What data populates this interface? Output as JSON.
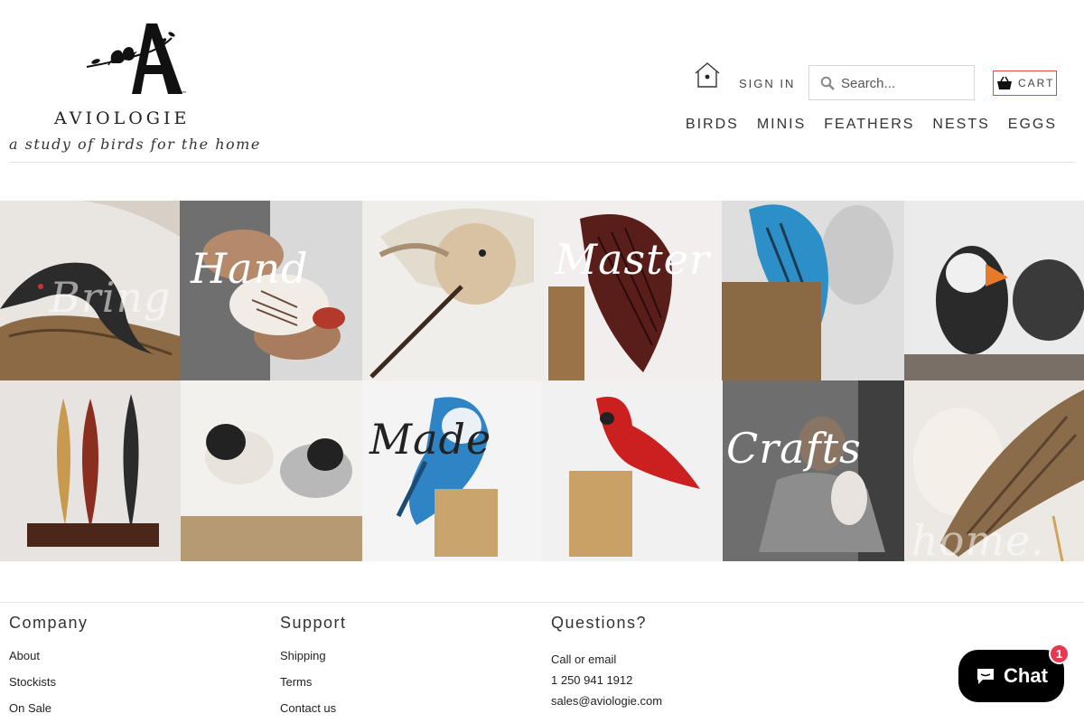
{
  "brand": {
    "name": "AVIOLOGIE",
    "tagline": "a study of birds for the home",
    "logo_letter": "A",
    "trademark": "™"
  },
  "header": {
    "birdhouse_icon": "birdhouse-icon",
    "sign_in_label": "SIGN IN",
    "search_placeholder": "Search...",
    "cart_label": "CART",
    "cart_border_color": "#e8443e"
  },
  "nav": {
    "items": [
      {
        "label": "BIRDS"
      },
      {
        "label": "MINIS"
      },
      {
        "label": "FEATHERS"
      },
      {
        "label": "NESTS"
      },
      {
        "label": "EGGS"
      }
    ]
  },
  "mosaic": {
    "overlay_words": [
      "Bring",
      "Hand",
      "Master",
      "Made",
      "Crafts",
      "home."
    ],
    "tiles": [
      {
        "subject": "carved loon"
      },
      {
        "subject": "hands carving"
      },
      {
        "subject": "carved sandpiper"
      },
      {
        "subject": "carved bird on wood block"
      },
      {
        "subject": "blue carved bird and carver"
      },
      {
        "subject": "carved puffin"
      },
      {
        "subject": "carved feathers on stand"
      },
      {
        "subject": "carved chickadees"
      },
      {
        "subject": "carved blue jay"
      },
      {
        "subject": "carved cardinal"
      },
      {
        "subject": "artisan carving"
      },
      {
        "subject": "carved curlew"
      }
    ]
  },
  "footer": {
    "company": {
      "heading": "Company",
      "links": [
        "About",
        "Stockists",
        "On Sale"
      ]
    },
    "support": {
      "heading": "Support",
      "links": [
        "Shipping",
        "Terms",
        "Contact us"
      ]
    },
    "questions": {
      "heading": "Questions?",
      "lines": [
        "Call or email",
        "1 250 941 1912",
        "sales@aviologie.com"
      ]
    }
  },
  "chat_widget": {
    "label": "Chat",
    "badge": "1",
    "badge_color": "#e8384f"
  }
}
